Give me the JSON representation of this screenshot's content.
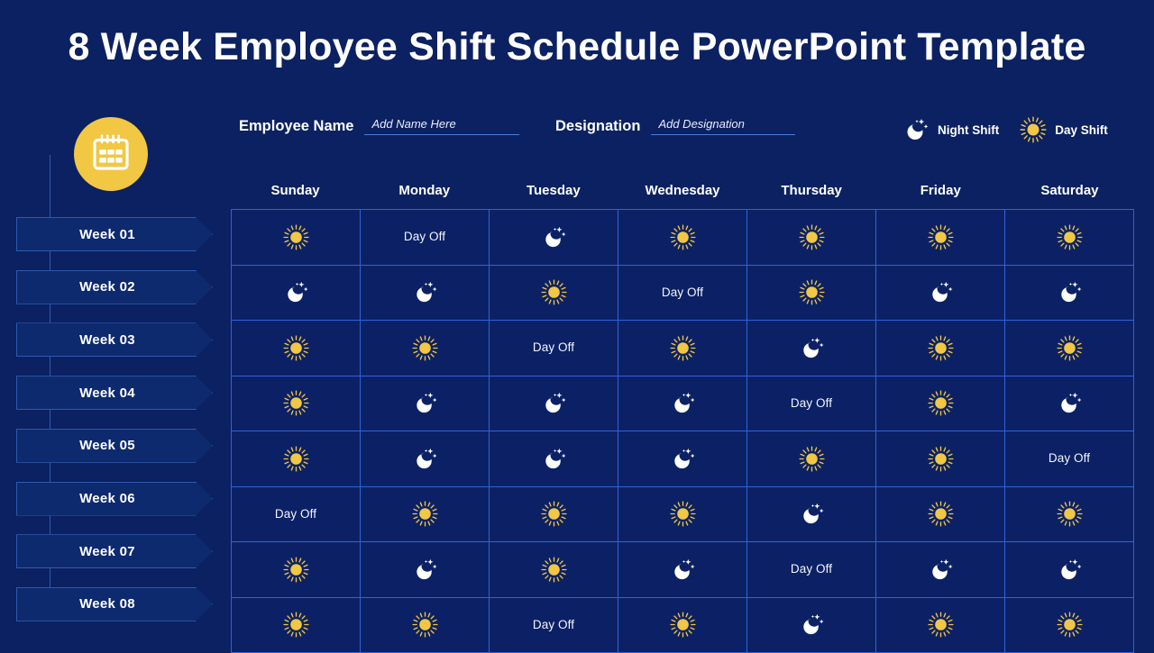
{
  "title": "8 Week Employee Shift Schedule PowerPoint Template",
  "colors": {
    "background": "#0b2161",
    "cell_background": "#0c2165",
    "grid_border": "#2f63d8",
    "accent_yellow": "#f1c743",
    "tag_fill": "#0e2a6e",
    "tag_border": "#2f59ad",
    "text_white": "#ffffff"
  },
  "header": {
    "employee_name_label": "Employee Name",
    "employee_name_placeholder": "Add Name Here",
    "designation_label": "Designation",
    "designation_placeholder": "Add Designation"
  },
  "legend": [
    {
      "icon": "moon-stars-icon",
      "label": "Night Shift"
    },
    {
      "icon": "sun-icon",
      "label": "Day Shift"
    }
  ],
  "sidebar": {
    "badge_icon": "calendar-icon",
    "items": [
      {
        "label": "Week 01"
      },
      {
        "label": "Week 02"
      },
      {
        "label": "Week 03"
      },
      {
        "label": "Week 04"
      },
      {
        "label": "Week 05"
      },
      {
        "label": "Week 06"
      },
      {
        "label": "Week 07"
      },
      {
        "label": "Week 08"
      }
    ]
  },
  "schedule": {
    "day_off_label": "Day Off",
    "columns": [
      "Sunday",
      "Monday",
      "Tuesday",
      "Wednesday",
      "Thursday",
      "Friday",
      "Saturday"
    ],
    "rows": [
      {
        "week": "Week 01",
        "cells": [
          "day",
          "off",
          "night",
          "day",
          "day",
          "day",
          "day"
        ]
      },
      {
        "week": "Week 02",
        "cells": [
          "night",
          "night",
          "day",
          "off",
          "day",
          "night",
          "night"
        ]
      },
      {
        "week": "Week 03",
        "cells": [
          "day",
          "day",
          "off",
          "day",
          "night",
          "day",
          "day"
        ]
      },
      {
        "week": "Week 04",
        "cells": [
          "day",
          "night",
          "night",
          "night",
          "off",
          "day",
          "night"
        ]
      },
      {
        "week": "Week 05",
        "cells": [
          "day",
          "night",
          "night",
          "night",
          "day",
          "day",
          "off"
        ]
      },
      {
        "week": "Week 06",
        "cells": [
          "off",
          "day",
          "day",
          "day",
          "night",
          "day",
          "day"
        ]
      },
      {
        "week": "Week 07",
        "cells": [
          "day",
          "night",
          "day",
          "night",
          "off",
          "night",
          "night"
        ]
      },
      {
        "week": "Week 08",
        "cells": [
          "day",
          "day",
          "off",
          "day",
          "night",
          "day",
          "day"
        ]
      }
    ]
  }
}
